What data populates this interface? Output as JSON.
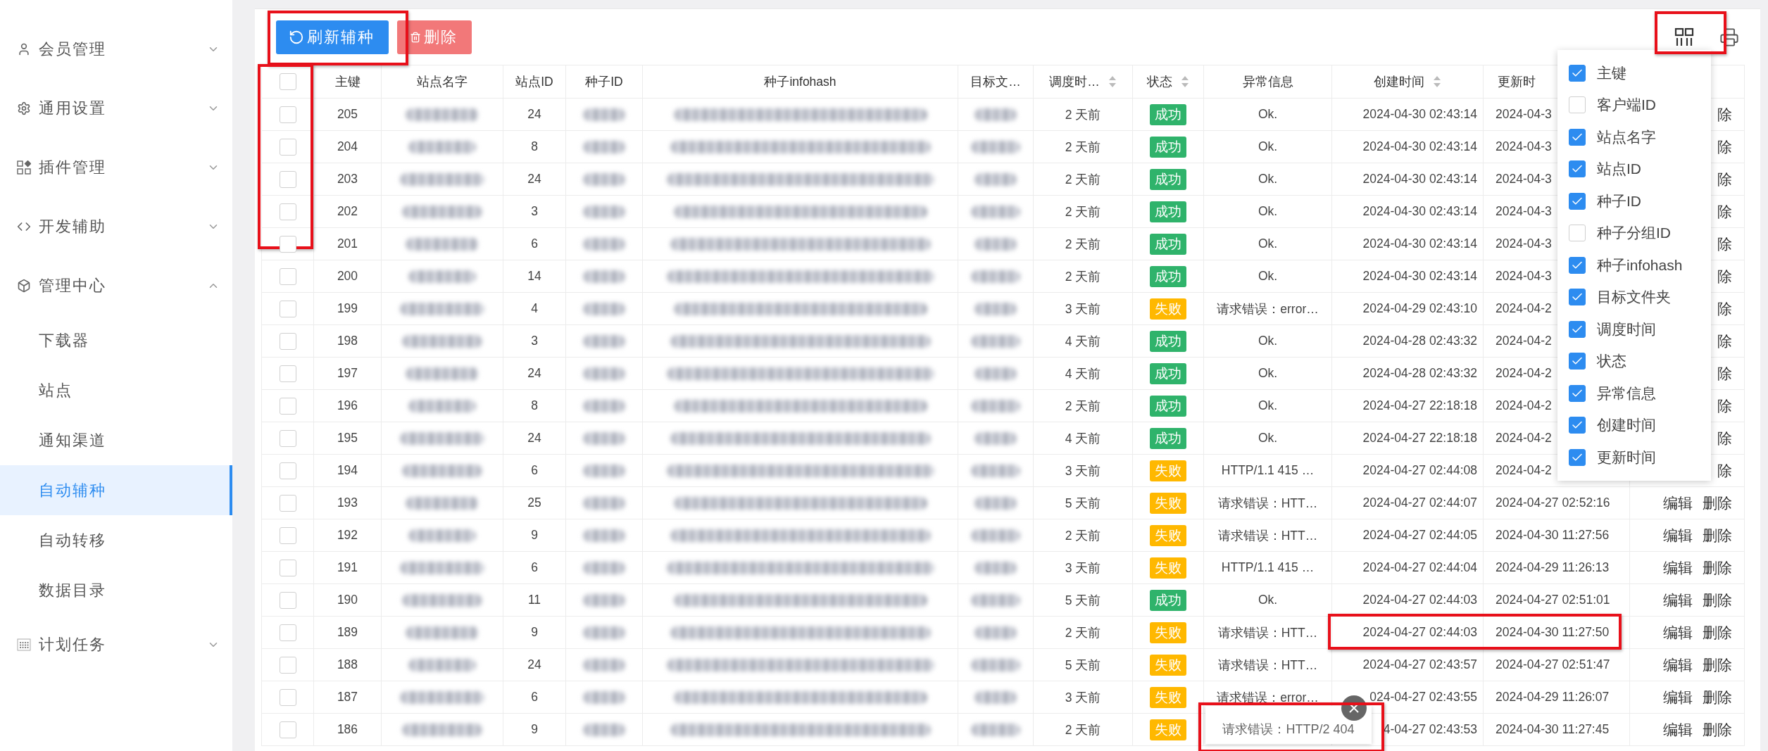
{
  "sidebar": {
    "items": [
      {
        "label": "会员管理",
        "expanded": false
      },
      {
        "label": "通用设置",
        "expanded": false
      },
      {
        "label": "插件管理",
        "expanded": false
      },
      {
        "label": "开发辅助",
        "expanded": false
      },
      {
        "label": "管理中心",
        "expanded": true,
        "children": [
          {
            "label": "下载器",
            "selected": false
          },
          {
            "label": "站点",
            "selected": false
          },
          {
            "label": "通知渠道",
            "selected": false
          },
          {
            "label": "自动辅种",
            "selected": true
          },
          {
            "label": "自动转移",
            "selected": false
          },
          {
            "label": "数据目录",
            "selected": false
          }
        ]
      },
      {
        "label": "计划任务",
        "expanded": false
      }
    ]
  },
  "toolbar": {
    "buttons": [
      {
        "kind": "refresh",
        "label": "刷新辅种",
        "disabled": false
      },
      {
        "kind": "delete",
        "label": "删除",
        "disabled": true
      }
    ]
  },
  "table": {
    "select_all": {
      "checked": false
    },
    "columns": [
      {
        "label": "主键",
        "sortable": false
      },
      {
        "label": "站点名字",
        "sortable": false
      },
      {
        "label": "站点ID",
        "sortable": false
      },
      {
        "label": "种子ID",
        "sortable": false
      },
      {
        "label": "种子infohash",
        "sortable": false
      },
      {
        "label": "目标文…",
        "sortable": false
      },
      {
        "label": "调度时…",
        "sortable": true
      },
      {
        "label": "状态",
        "sortable": true
      },
      {
        "label": "异常信息",
        "sortable": false
      },
      {
        "label": "创建时间",
        "sortable": true
      },
      {
        "label": "更新时",
        "sortable": false
      }
    ],
    "rows": [
      {
        "checked": false,
        "id": "205",
        "site_id": "24",
        "scheduled": "2 天前",
        "status": {
          "label": "成功",
          "kind": "success"
        },
        "error": "Ok.",
        "created": "2024-04-30 02:43:14",
        "updated": "2024-04-3",
        "actions": [
          {
            "kind": "delete",
            "label": "除"
          }
        ]
      },
      {
        "checked": false,
        "id": "204",
        "site_id": "8",
        "scheduled": "2 天前",
        "status": {
          "label": "成功",
          "kind": "success"
        },
        "error": "Ok.",
        "created": "2024-04-30 02:43:14",
        "updated": "2024-04-3",
        "actions": [
          {
            "kind": "delete",
            "label": "除"
          }
        ]
      },
      {
        "checked": false,
        "id": "203",
        "site_id": "24",
        "scheduled": "2 天前",
        "status": {
          "label": "成功",
          "kind": "success"
        },
        "error": "Ok.",
        "created": "2024-04-30 02:43:14",
        "updated": "2024-04-3",
        "actions": [
          {
            "kind": "delete",
            "label": "除"
          }
        ]
      },
      {
        "checked": false,
        "id": "202",
        "site_id": "3",
        "scheduled": "2 天前",
        "status": {
          "label": "成功",
          "kind": "success"
        },
        "error": "Ok.",
        "created": "2024-04-30 02:43:14",
        "updated": "2024-04-3",
        "actions": [
          {
            "kind": "delete",
            "label": "除"
          }
        ]
      },
      {
        "checked": false,
        "id": "201",
        "site_id": "6",
        "scheduled": "2 天前",
        "status": {
          "label": "成功",
          "kind": "success"
        },
        "error": "Ok.",
        "created": "2024-04-30 02:43:14",
        "updated": "2024-04-3",
        "actions": [
          {
            "kind": "delete",
            "label": "除"
          }
        ]
      },
      {
        "checked": false,
        "id": "200",
        "site_id": "14",
        "scheduled": "2 天前",
        "status": {
          "label": "成功",
          "kind": "success"
        },
        "error": "Ok.",
        "created": "2024-04-30 02:43:14",
        "updated": "2024-04-3",
        "actions": [
          {
            "kind": "delete",
            "label": "除"
          }
        ]
      },
      {
        "checked": false,
        "id": "199",
        "site_id": "4",
        "scheduled": "3 天前",
        "status": {
          "label": "失败",
          "kind": "fail"
        },
        "error": "请求错误：error…",
        "created": "2024-04-29 02:43:10",
        "updated": "2024-04-2",
        "actions": [
          {
            "kind": "delete",
            "label": "除"
          }
        ]
      },
      {
        "checked": false,
        "id": "198",
        "site_id": "3",
        "scheduled": "4 天前",
        "status": {
          "label": "成功",
          "kind": "success"
        },
        "error": "Ok.",
        "created": "2024-04-28 02:43:32",
        "updated": "2024-04-2",
        "actions": [
          {
            "kind": "delete",
            "label": "除"
          }
        ]
      },
      {
        "checked": false,
        "id": "197",
        "site_id": "24",
        "scheduled": "4 天前",
        "status": {
          "label": "成功",
          "kind": "success"
        },
        "error": "Ok.",
        "created": "2024-04-28 02:43:32",
        "updated": "2024-04-2",
        "actions": [
          {
            "kind": "delete",
            "label": "除"
          }
        ]
      },
      {
        "checked": false,
        "id": "196",
        "site_id": "8",
        "scheduled": "2 天前",
        "status": {
          "label": "成功",
          "kind": "success"
        },
        "error": "Ok.",
        "created": "2024-04-27 22:18:18",
        "updated": "2024-04-2",
        "actions": [
          {
            "kind": "delete",
            "label": "除"
          }
        ]
      },
      {
        "checked": false,
        "id": "195",
        "site_id": "24",
        "scheduled": "4 天前",
        "status": {
          "label": "成功",
          "kind": "success"
        },
        "error": "Ok.",
        "created": "2024-04-27 22:18:18",
        "updated": "2024-04-2",
        "actions": [
          {
            "kind": "delete",
            "label": "除"
          }
        ]
      },
      {
        "checked": false,
        "id": "194",
        "site_id": "6",
        "scheduled": "3 天前",
        "status": {
          "label": "失败",
          "kind": "fail"
        },
        "error": "HTTP/1.1 415 …",
        "created": "2024-04-27 02:44:08",
        "updated": "2024-04-2",
        "actions": [
          {
            "kind": "delete",
            "label": "除"
          }
        ]
      },
      {
        "checked": false,
        "id": "193",
        "site_id": "25",
        "scheduled": "5 天前",
        "status": {
          "label": "失败",
          "kind": "fail"
        },
        "error": "请求错误：HTT…",
        "created": "2024-04-27 02:44:07",
        "updated": "2024-04-27 02:52:16",
        "actions": [
          {
            "kind": "edit",
            "label": "编辑"
          },
          {
            "kind": "delete",
            "label": "删除"
          }
        ]
      },
      {
        "checked": false,
        "id": "192",
        "site_id": "9",
        "scheduled": "2 天前",
        "status": {
          "label": "失败",
          "kind": "fail"
        },
        "error": "请求错误：HTT…",
        "created": "2024-04-27 02:44:05",
        "updated": "2024-04-30 11:27:56",
        "actions": [
          {
            "kind": "edit",
            "label": "编辑"
          },
          {
            "kind": "delete",
            "label": "删除"
          }
        ]
      },
      {
        "checked": false,
        "id": "191",
        "site_id": "6",
        "scheduled": "3 天前",
        "status": {
          "label": "失败",
          "kind": "fail"
        },
        "error": "HTTP/1.1 415 …",
        "created": "2024-04-27 02:44:04",
        "updated": "2024-04-29 11:26:13",
        "actions": [
          {
            "kind": "edit",
            "label": "编辑"
          },
          {
            "kind": "delete",
            "label": "删除"
          }
        ]
      },
      {
        "checked": false,
        "id": "190",
        "site_id": "11",
        "scheduled": "5 天前",
        "status": {
          "label": "成功",
          "kind": "success"
        },
        "error": "Ok.",
        "created": "2024-04-27 02:44:03",
        "updated": "2024-04-27 02:51:01",
        "actions": [
          {
            "kind": "edit",
            "label": "编辑"
          },
          {
            "kind": "delete",
            "label": "删除"
          }
        ]
      },
      {
        "checked": false,
        "id": "189",
        "site_id": "9",
        "scheduled": "2 天前",
        "status": {
          "label": "失败",
          "kind": "fail"
        },
        "error": "请求错误：HTT…",
        "created": "2024-04-27 02:44:03",
        "updated": "2024-04-30 11:27:50",
        "actions": [
          {
            "kind": "edit",
            "label": "编辑"
          },
          {
            "kind": "delete",
            "label": "删除"
          }
        ]
      },
      {
        "checked": false,
        "id": "188",
        "site_id": "24",
        "scheduled": "5 天前",
        "status": {
          "label": "失败",
          "kind": "fail"
        },
        "error": "请求错误：HTT…",
        "created": "2024-04-27 02:43:57",
        "updated": "2024-04-27 02:51:47",
        "actions": [
          {
            "kind": "edit",
            "label": "编辑"
          },
          {
            "kind": "delete",
            "label": "删除"
          }
        ]
      },
      {
        "checked": false,
        "id": "187",
        "site_id": "6",
        "scheduled": "3 天前",
        "status": {
          "label": "失败",
          "kind": "fail"
        },
        "error": "请求错误：error…",
        "created": "024-04-27 02:43:55",
        "updated": "2024-04-29 11:26:07",
        "actions": [
          {
            "kind": "edit",
            "label": "编辑"
          },
          {
            "kind": "delete",
            "label": "删除"
          }
        ]
      },
      {
        "checked": false,
        "id": "186",
        "site_id": "9",
        "scheduled": "2 天前",
        "status": {
          "label": "失败",
          "kind": "fail"
        },
        "created": "4-04-27 02:43:53",
        "updated": "2024-04-30 11:27:45",
        "actions": [
          {
            "kind": "edit",
            "label": "编辑"
          },
          {
            "kind": "delete",
            "label": "删除"
          }
        ]
      }
    ]
  },
  "column_menu": {
    "items": [
      {
        "label": "主键",
        "checked": true
      },
      {
        "label": "客户端ID",
        "checked": false
      },
      {
        "label": "站点名字",
        "checked": true
      },
      {
        "label": "站点ID",
        "checked": true
      },
      {
        "label": "种子ID",
        "checked": true
      },
      {
        "label": "种子分组ID",
        "checked": false
      },
      {
        "label": "种子infohash",
        "checked": true
      },
      {
        "label": "目标文件夹",
        "checked": true
      },
      {
        "label": "调度时间",
        "checked": true
      },
      {
        "label": "状态",
        "checked": true
      },
      {
        "label": "异常信息",
        "checked": true
      },
      {
        "label": "创建时间",
        "checked": true
      },
      {
        "label": "更新时间",
        "checked": true
      }
    ]
  },
  "tooltip": {
    "text": "请求错误：HTTP/2 404"
  }
}
